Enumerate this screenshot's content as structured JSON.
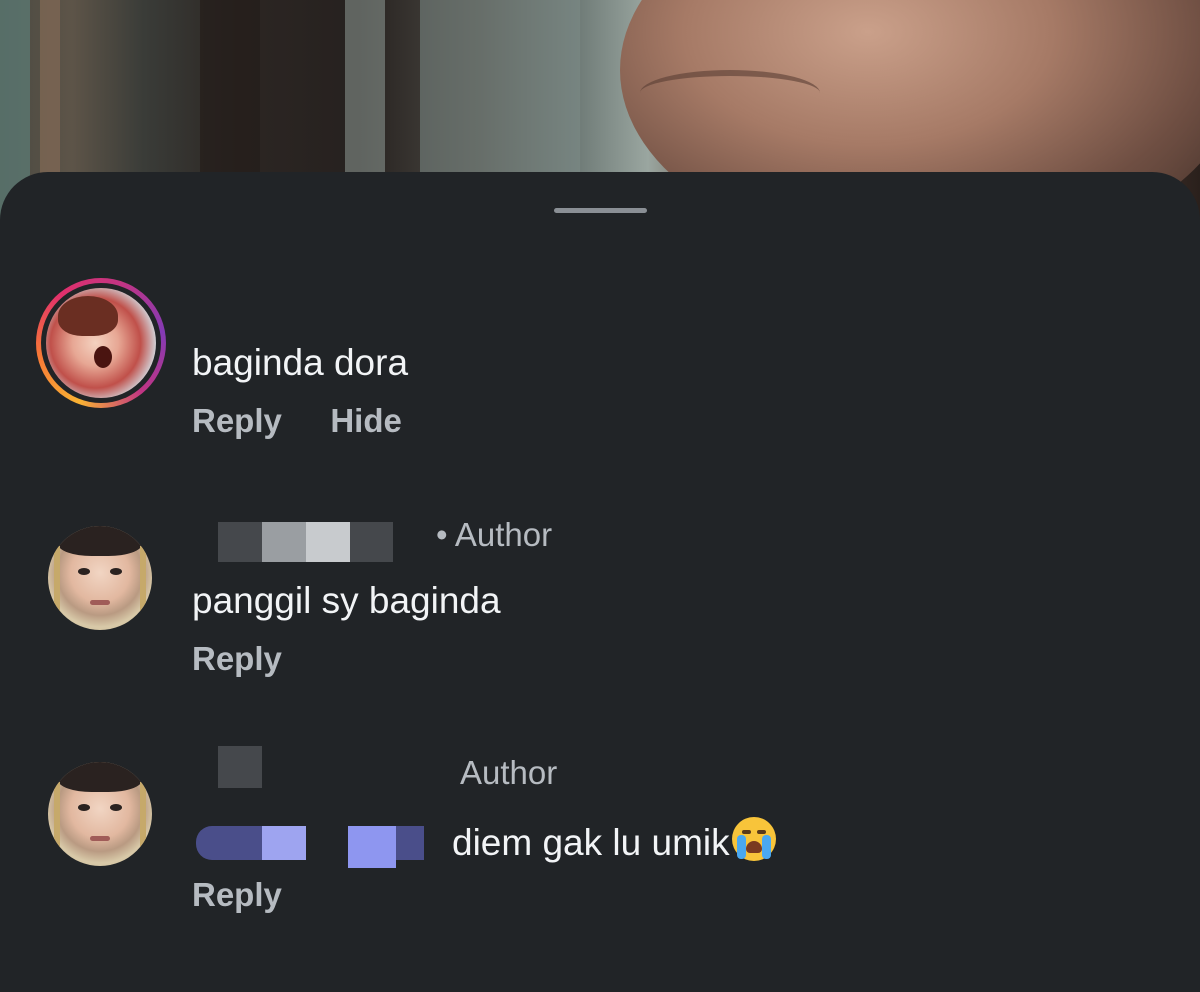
{
  "comments": [
    {
      "text": "baginda dora",
      "actions": [
        "Reply",
        "Hide"
      ]
    },
    {
      "author_tag": "• Author",
      "text": "panggil sy baginda",
      "actions": [
        "Reply"
      ]
    },
    {
      "author_tag": "Author",
      "text": "diem gak lu umik",
      "emoji": "loudly-crying-face",
      "actions": [
        "Reply"
      ]
    }
  ],
  "colors": {
    "sheet_bg": "#212427",
    "primary_text": "#f2f4f6",
    "secondary_text": "#b6bbc1",
    "handle": "#8a8f95"
  }
}
